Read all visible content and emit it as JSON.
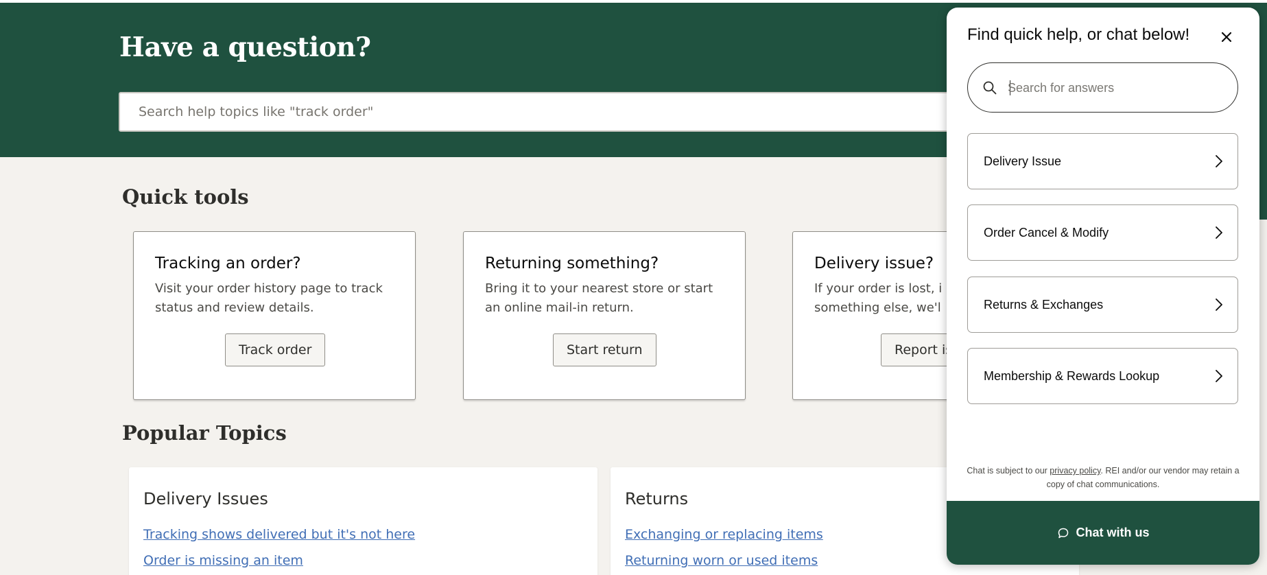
{
  "hero": {
    "title": "Have a question?",
    "search_placeholder": "Search help topics like \"track order\""
  },
  "quick_tools": {
    "title": "Quick tools",
    "cards": [
      {
        "title": "Tracking an order?",
        "desc_line1": "Visit your order history page to track",
        "desc_line2": "status and review details.",
        "button": "Track order"
      },
      {
        "title": "Returning something?",
        "desc_line1": "Bring it to your nearest store or start",
        "desc_line2": "an online mail-in return.",
        "button": "Start return"
      },
      {
        "title": "Delivery issue?",
        "desc_line1": "If your order is lost, i",
        "desc_line2": "something else, we'l",
        "button": "Report is"
      }
    ]
  },
  "popular_topics": {
    "title": "Popular Topics",
    "cards": [
      {
        "title": "Delivery Issues",
        "links": [
          "Tracking shows delivered but it's not here",
          "Order is missing an item"
        ]
      },
      {
        "title": "Returns",
        "links": [
          "Exchanging or replacing items",
          "Returning worn or used items"
        ]
      }
    ]
  },
  "chat": {
    "header": "Find quick help, or chat below!",
    "search_placeholder": "Search for answers",
    "options": [
      "Delivery Issue",
      "Order Cancel & Modify",
      "Returns & Exchanges",
      "Membership & Rewards Lookup"
    ],
    "disclaimer_prefix": "Chat is subject to our ",
    "disclaimer_link": "privacy policy",
    "disclaimer_suffix": ". REI and/or our vendor may retain a copy of chat communications.",
    "chat_button": "Chat with us"
  },
  "colors": {
    "brand_green": "#1f513f",
    "page_bg": "#f4f2ee",
    "link_blue": "#406eb5"
  }
}
